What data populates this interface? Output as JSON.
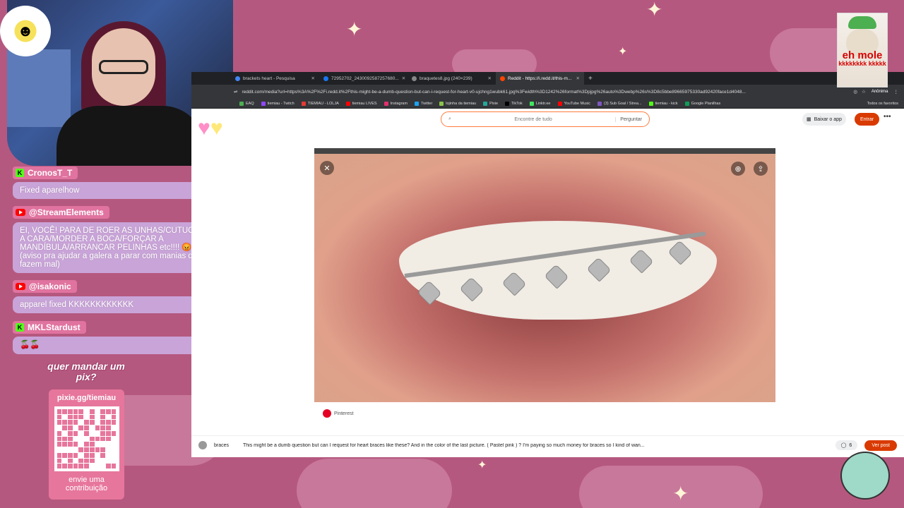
{
  "chat": {
    "partial_top": "…",
    "messages": [
      {
        "platform": "kick",
        "user": "CronosT_T",
        "text": "Fixed aparelhow"
      },
      {
        "platform": "youtube",
        "user": "@StreamElements",
        "text": "EI, VOCÊ! PARA DE ROER AS UNHAS/CUTUCAR A CARA/MORDER A BOCA/FORÇAR A MANDÍBULA/ARRANCAR PELINHAS etc!!!! 😡😡 (aviso pra ajudar a galera a parar com manias que fazem mal)"
      },
      {
        "platform": "youtube",
        "user": "@isakonic",
        "text": "apparel fixed KKKKKKKKKKKK"
      },
      {
        "platform": "kick",
        "user": "MKLStardust",
        "text": "🍒🍒"
      }
    ]
  },
  "pix": {
    "title": "quer mandar um pix?",
    "url": "pixie.gg/tiemiau",
    "footer": "envie uma contribuição"
  },
  "browser": {
    "tabs": [
      {
        "label": "brackets heart - Pesquisa",
        "active": false,
        "color": "#4285f4"
      },
      {
        "label": "72952702_2430092587257680...",
        "active": false,
        "color": "#1877f2"
      },
      {
        "label": "braquetes8.jpg (240×239)",
        "active": false,
        "color": "#888888"
      },
      {
        "label": "Reddit - https://i.redd.it/this-m...",
        "active": true,
        "color": "#ff4500"
      }
    ],
    "url": "reddit.com/media?url=https%3A%2F%2Fi.redd.it%2Fthis-might-be-a-dumb-question-but-can-i-request-for-heart-v0-ujchng1wubk61.jpg%3Fwidth%3D1242%26format%3Dpjpg%26auto%3Dwebp%26s%3D8c5bbe89665975330ad92420face1d4048...",
    "incognito_label": "Anônima",
    "bookmarks": [
      {
        "label": "EAQ",
        "color": "#4caf50"
      },
      {
        "label": "tiemiau - Twitch",
        "color": "#9146ff"
      },
      {
        "label": "TIEMIAU - LOLJA",
        "color": "#e53935"
      },
      {
        "label": "tiemiau LIVES",
        "color": "#ff0000"
      },
      {
        "label": "Instagram",
        "color": "#e1306c"
      },
      {
        "label": "Twitter",
        "color": "#1da1f2"
      },
      {
        "label": "lojinha da tiemiau",
        "color": "#8bc34a"
      },
      {
        "label": "Pixie",
        "color": "#26a69a"
      },
      {
        "label": "TikTok",
        "color": "#000000"
      },
      {
        "label": "Linktr.ee",
        "color": "#43e660"
      },
      {
        "label": "YouTube Music",
        "color": "#ff0000"
      },
      {
        "label": "(3) Sub Goal / Strea...",
        "color": "#7e57c2"
      },
      {
        "label": "tiemiau - kick",
        "color": "#53fc18"
      },
      {
        "label": "Google Planilhas",
        "color": "#0f9d58"
      }
    ],
    "bookmarks_right": "Todos os favoritos"
  },
  "reddit": {
    "search_placeholder": "Encontre de tudo",
    "ask_label": "Perguntar",
    "get_app_label": "Baixar o app",
    "login_label": "Entrar",
    "more_label": "•••",
    "source_label": "Pinterest",
    "post": {
      "subreddit": "braces",
      "title": "This might be a dumb question but can I request for heart braces like these? And in the color of the last picture. ( Pastel pink ) ? I'm paying so much money for braces so I kind of wan...",
      "comments": "6",
      "view_post_label": "Ver post"
    }
  },
  "overlay": {
    "meme_line1": "eh mole",
    "meme_line2": "kkkkkkkk kkkkk"
  },
  "colors": {
    "background": "#b5587f",
    "chat_user_bg": "#e0739f",
    "chat_msg_bg": "#c9a4d8",
    "reddit_orange": "#d93a00"
  }
}
